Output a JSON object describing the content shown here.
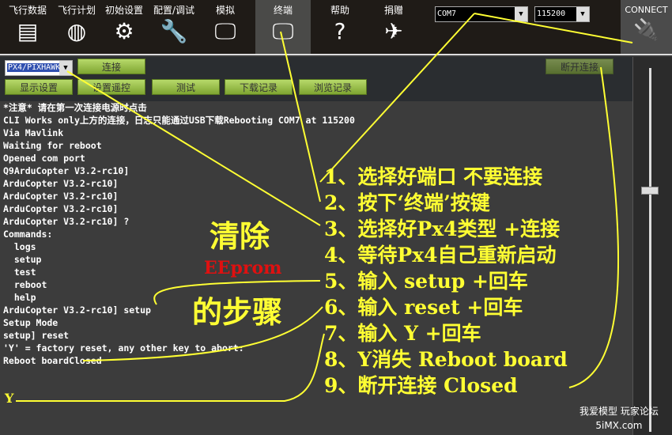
{
  "nav": [
    {
      "label": "飞行数据",
      "icon": "flight-data-icon",
      "glyph": "▤"
    },
    {
      "label": "飞行计划",
      "icon": "flight-plan-icon",
      "glyph": "◍"
    },
    {
      "label": "初始设置",
      "icon": "initial-setup-icon",
      "glyph": "⚙"
    },
    {
      "label": "配置/调试",
      "icon": "config-tuning-icon",
      "glyph": "🔧"
    },
    {
      "label": "模拟",
      "icon": "simulation-icon",
      "glyph": "🖵"
    },
    {
      "label": "终端",
      "icon": "terminal-icon",
      "glyph": "🖵"
    },
    {
      "label": "帮助",
      "icon": "help-icon",
      "glyph": "?"
    },
    {
      "label": "捐赠",
      "icon": "donate-icon",
      "glyph": "✈"
    }
  ],
  "port": "COM7",
  "baud": "115200",
  "connect_label": "CONNECT",
  "panel": {
    "board": "PX4/PIXHAWK",
    "connect": "连接",
    "disconnect": "断开连接",
    "buttons": [
      "显示设置",
      "设置遥控",
      "测试",
      "下载记录",
      "浏览记录"
    ]
  },
  "terminal": [
    "*注意* 请在第一次连接电源时点击",
    "CLI Works only上方的连接，日志只能通过USB下载Rebooting COM7 at 115200",
    "Via Mavlink",
    "Waiting for reboot",
    "Opened com port",
    "Q9ArduCopter V3.2-rc10]",
    "ArduCopter V3.2-rc10]",
    "ArduCopter V3.2-rc10]",
    "ArduCopter V3.2-rc10]",
    "ArduCopter V3.2-rc10] ?",
    "Commands:",
    "  logs",
    "  setup",
    "  test",
    "  reboot",
    "  help",
    "ArduCopter V3.2-rc10] setup",
    "Setup Mode",
    "",
    "",
    "setup] reset",
    "",
    "'Y' = factory reset, any other key to abort:",
    "",
    "Reboot boardClosed"
  ],
  "annotations": {
    "title1": "清除",
    "title2": "EEprom",
    "title3": "的步骤",
    "typed": "Y",
    "steps": [
      "1、选择好端口 不要连接",
      "2、按下‘终端’按键",
      "3、选择好Px4类型 +连接",
      "4、等待Px4自己重新启动",
      "5、输入 setup +回车",
      "6、输入 reset +回车",
      "7、输入 Y +回车",
      "8、Y消失 Reboot board",
      "9、断开连接 Closed"
    ]
  },
  "watermark": {
    "line1": "我爱模型 玩家论坛",
    "line2": "5iMX.com"
  },
  "colors": {
    "annotation": "#ffff33",
    "eeprom": "#e01010",
    "button": "#9cc84a"
  }
}
